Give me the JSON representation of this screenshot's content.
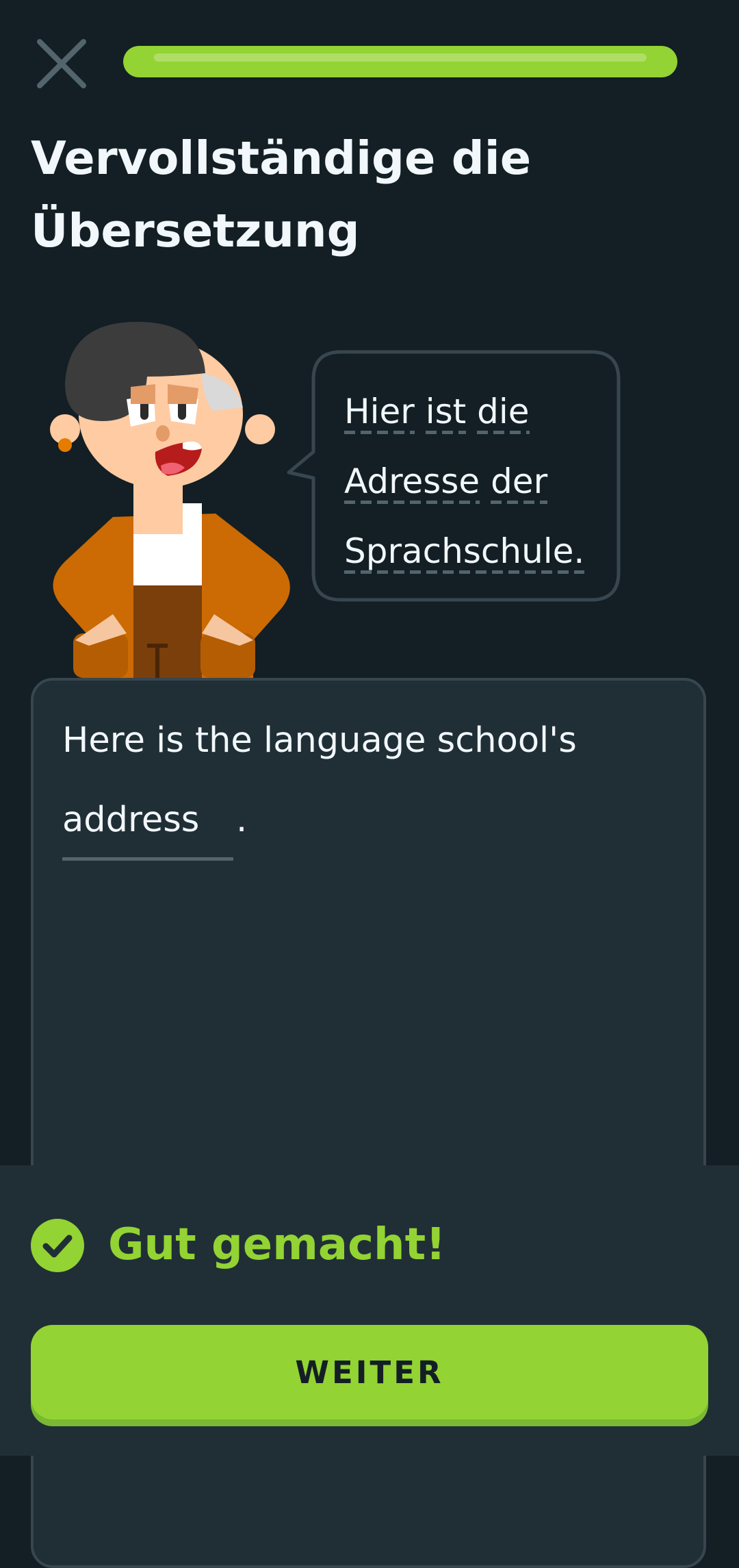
{
  "header": {
    "close_icon": "close-icon",
    "progress_fraction": 1.0
  },
  "title": "Vervollständige die Übersetzung",
  "prompt": {
    "lines": [
      [
        "Hier",
        "ist",
        "die"
      ],
      [
        "Adresse",
        "der"
      ],
      [
        "Sprachschule."
      ]
    ]
  },
  "answer": {
    "prefix": "Here is the language school's",
    "blank_value": "address",
    "suffix": "."
  },
  "feedback": {
    "title": "Gut gemacht!",
    "icon": "checkmark-icon"
  },
  "footer": {
    "button_label": "WEITER"
  },
  "colors": {
    "background": "#131f24",
    "panel": "#202f36",
    "border": "#37464f",
    "accent_green": "#93d333",
    "text": "#f1f7fb"
  }
}
